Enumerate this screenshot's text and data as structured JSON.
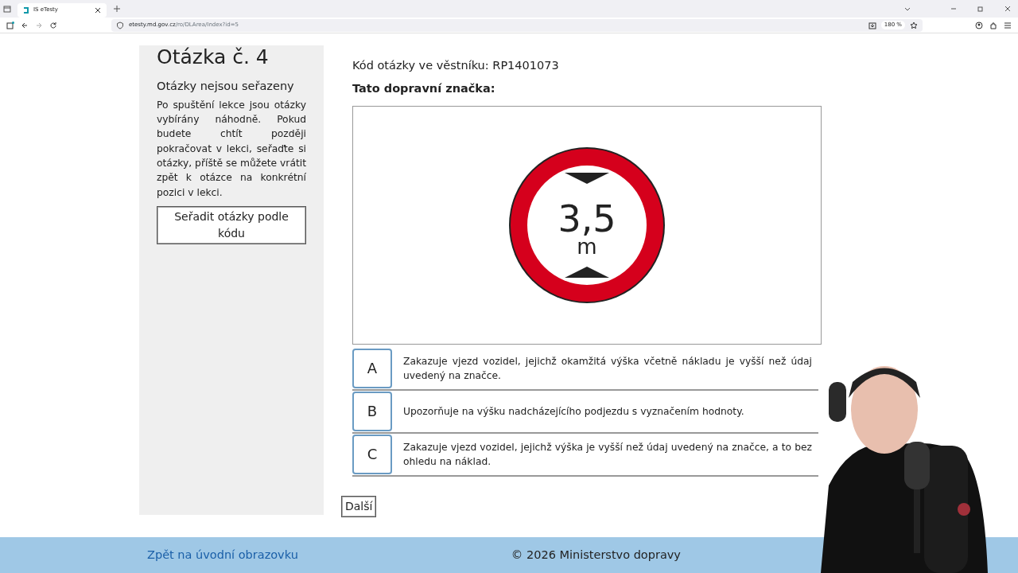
{
  "browser": {
    "tab_title": "IS eTesty",
    "url_host": "etesty.md.gov.cz",
    "url_path": "/ro/DLArea/Index?id=5",
    "zoom": "180 %"
  },
  "sidebar": {
    "title": "Otázka č. 4",
    "subtitle": "Otázky nejsou seřazeny",
    "text": "Po spuštění lekce jsou otázky vybírány náhodně. Pokud budete chtít později pokračovat v lekci, seřaďte si otázky, příště se můžete vrátit zpět k otázce na konkrétní pozici v lekci.",
    "button": "Seřadit otázky podle kódu"
  },
  "question": {
    "code": "Kód otázky ve věstníku: RP1401073",
    "prompt": "Tato dopravní značka:",
    "sign": {
      "value": "3,5",
      "unit": "m"
    }
  },
  "answers": [
    {
      "letter": "A",
      "text": "Zakazuje vjezd vozidel, jejichž okamžitá výška včetně nákladu je vyšší než údaj uvedený na značce."
    },
    {
      "letter": "B",
      "text": "Upozorňuje na výšku nadcházejícího podjezdu s vyznačením hodnoty."
    },
    {
      "letter": "C",
      "text": "Zakazuje vjezd vozidel, jejichž výška je vyšší než údaj uvedený na značce, a to bez ohledu na náklad."
    }
  ],
  "next_button": "Další",
  "footer": {
    "link": "Zpět na úvodní obrazovku",
    "copyright": "© 2026 Ministerstvo dopravy"
  }
}
